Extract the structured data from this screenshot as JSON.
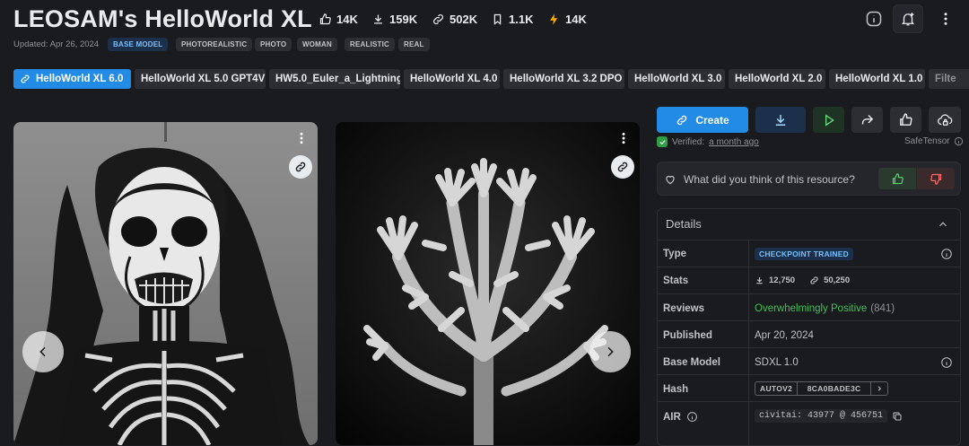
{
  "header": {
    "title": "LEOSAM's HelloWorld XL",
    "stats": [
      {
        "icon": "thumbs-up-icon",
        "value": "14K"
      },
      {
        "icon": "download-icon",
        "value": "159K"
      },
      {
        "icon": "link-icon",
        "value": "502K"
      },
      {
        "icon": "bookmark-icon",
        "value": "1.1K"
      },
      {
        "icon": "lightning-icon",
        "value": "14K"
      }
    ],
    "updated": "Updated: Apr 26, 2024",
    "model_tag": "BASE MODEL",
    "tags": [
      "PHOTOREALISTIC",
      "PHOTO",
      "WOMAN",
      "REALISTIC",
      "REAL"
    ]
  },
  "versions": [
    "HelloWorld XL 6.0",
    "HelloWorld XL 5.0 GPT4V",
    "HW5.0_Euler_a_Lightning",
    "HelloWorld XL 4.0",
    "HelloWorld XL 3.2 DPO",
    "HelloWorld XL 3.0",
    "HelloWorld XL 2.0",
    "HelloWorld XL 1.0",
    "Filte"
  ],
  "actions": {
    "create_label": "Create",
    "verified_label": "Verified:",
    "verified_time": "a month ago",
    "safetensor_label": "SafeTensor"
  },
  "feedback": {
    "question": "What did you think of this resource?"
  },
  "details": {
    "title": "Details",
    "type_label": "Type",
    "type_value": "CHECKPOINT TRAINED",
    "stats_label": "Stats",
    "stats_downloads": "12,750",
    "stats_generations": "50,250",
    "reviews_label": "Reviews",
    "reviews_value": "Overwhelmingly Positive",
    "reviews_count": "(841)",
    "published_label": "Published",
    "published_value": "Apr 20, 2024",
    "base_model_label": "Base Model",
    "base_model_value": "SDXL 1.0",
    "hash_label": "Hash",
    "hash_type": "AUTOV2",
    "hash_value": "8CA0BADE3C",
    "air_label": "AIR",
    "air_value": "civitai: 43977 @ 456751"
  },
  "colors": {
    "accent": "#228be6",
    "positive": "#40c057",
    "background": "#1a1b1e"
  }
}
